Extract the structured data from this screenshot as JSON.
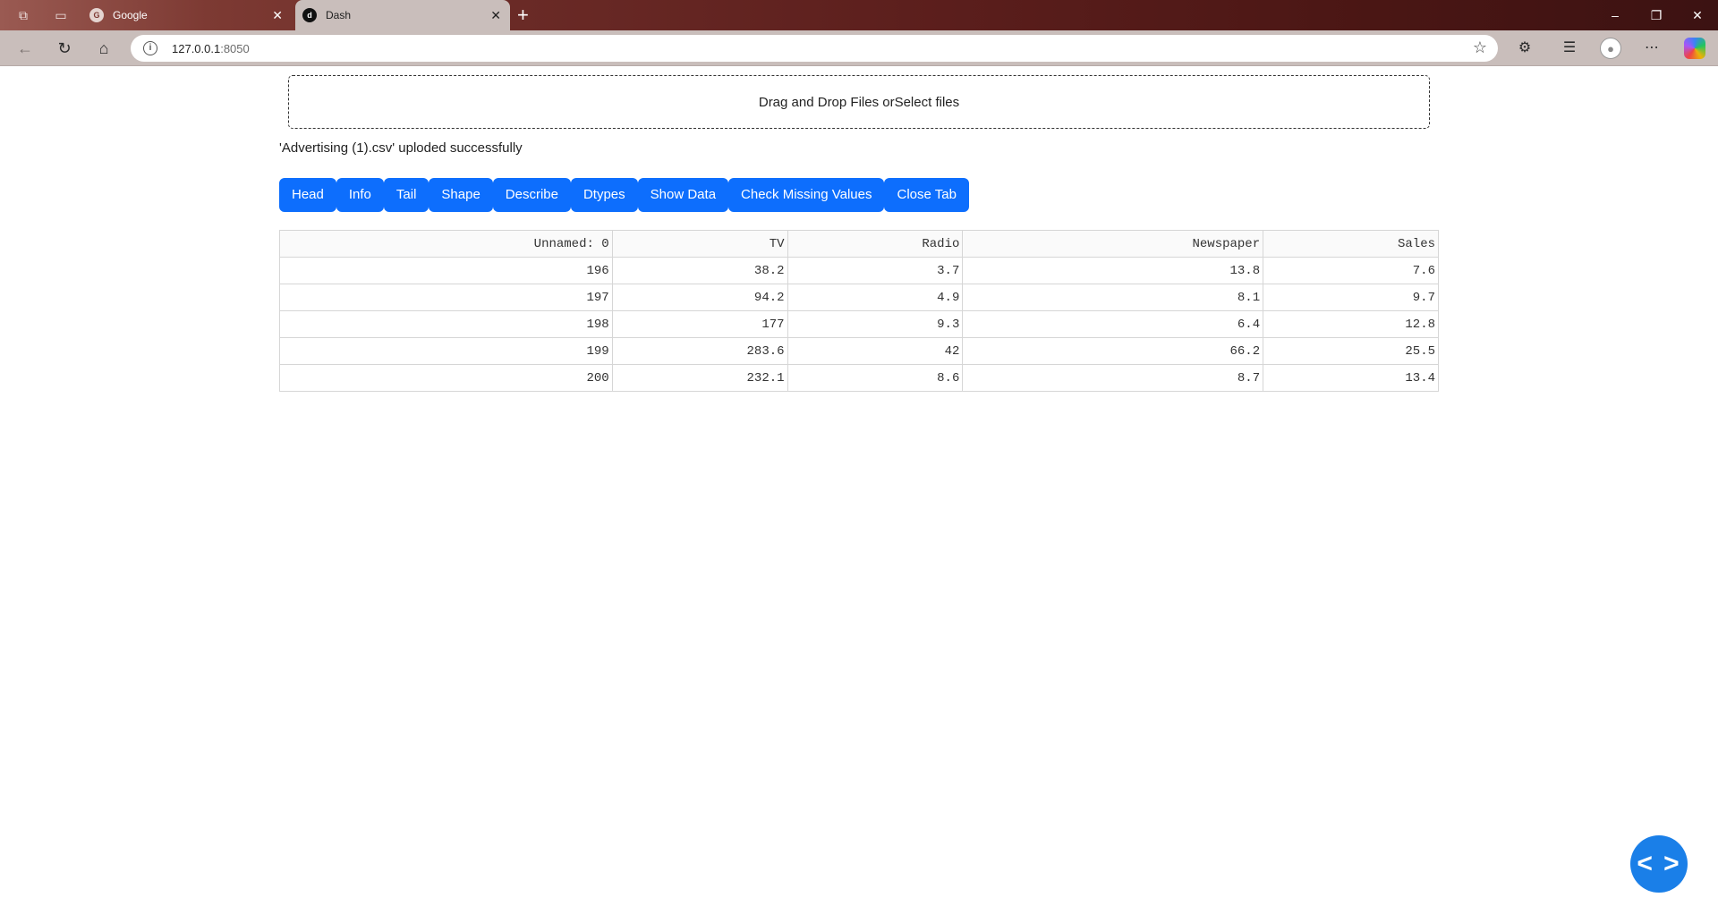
{
  "browser": {
    "tabs": [
      {
        "title": "Google",
        "favicon": "G",
        "active": false
      },
      {
        "title": "Dash",
        "favicon": "d",
        "active": true
      }
    ],
    "url_host": "127.0.0.1",
    "url_port": ":8050",
    "window_controls": {
      "minimize": "–",
      "restore": "❐",
      "close": "✕"
    }
  },
  "upload": {
    "dropzone_text": "Drag and Drop Files orSelect files",
    "status_message": "'Advertising (1).csv' uploded successfully"
  },
  "actions": [
    {
      "label": "Head"
    },
    {
      "label": "Info"
    },
    {
      "label": "Tail"
    },
    {
      "label": "Shape"
    },
    {
      "label": "Describe"
    },
    {
      "label": "Dtypes"
    },
    {
      "label": "Show Data"
    },
    {
      "label": "Check Missing Values"
    },
    {
      "label": "Close Tab"
    }
  ],
  "table": {
    "columns": [
      "Unnamed: 0",
      "TV",
      "Radio",
      "Newspaper",
      "Sales"
    ],
    "rows": [
      [
        "196",
        "38.2",
        "3.7",
        "13.8",
        "7.6"
      ],
      [
        "197",
        "94.2",
        "4.9",
        "8.1",
        "9.7"
      ],
      [
        "198",
        "177",
        "9.3",
        "6.4",
        "12.8"
      ],
      [
        "199",
        "283.6",
        "42",
        "66.2",
        "25.5"
      ],
      [
        "200",
        "232.1",
        "8.6",
        "8.7",
        "13.4"
      ]
    ]
  },
  "debug_button": {
    "symbol": "< >",
    "icon": "code-icon"
  },
  "colors": {
    "primary_button": "#0d6efd",
    "fab": "#1a7fe8"
  }
}
